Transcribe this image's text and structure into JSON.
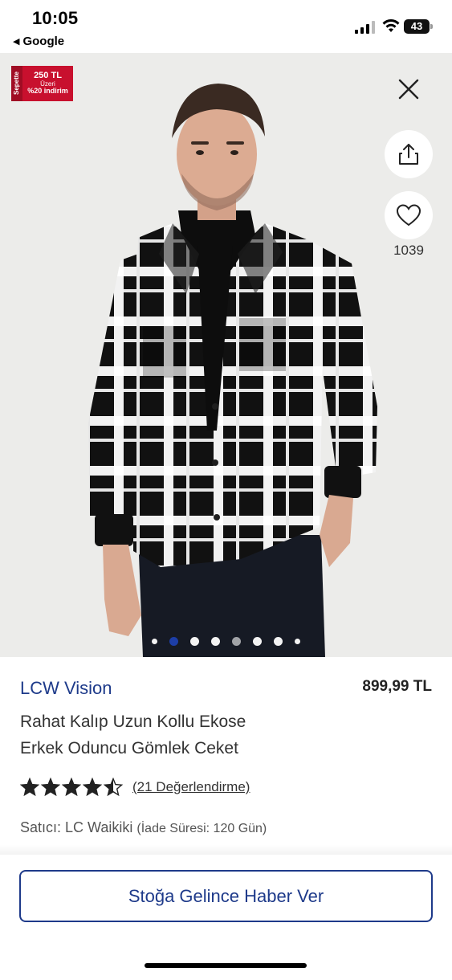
{
  "status_bar": {
    "time": "10:05",
    "back_app": "Google",
    "battery": "43"
  },
  "promo": {
    "side": "Sepette",
    "amount": "250 TL",
    "threshold": "Üzeri",
    "discount": "%20 indirim"
  },
  "favorites": {
    "count": "1039"
  },
  "carousel": {
    "total": 8,
    "active_index": 1
  },
  "product": {
    "brand": "LCW Vision",
    "price": "899,99 TL",
    "title_line1": "Rahat Kalıp Uzun Kollu Ekose",
    "title_line2": "Erkek Oduncu Gömlek Ceket",
    "rating": 4.5,
    "reviews": "(21 Değerlendirme)",
    "seller": "Satıcı: LC Waikiki",
    "return_period": "(İade Süresi: 120 Gün)"
  },
  "cta": {
    "label": "Stoğa Gelince Haber Ver"
  },
  "icons": {
    "close": "close-icon",
    "share": "share-icon",
    "favorite": "heart-icon",
    "star": "star-icon"
  },
  "colors": {
    "brand": "#1d3a8a",
    "promo": "#c8102e",
    "dot_active": "#1e40af"
  }
}
